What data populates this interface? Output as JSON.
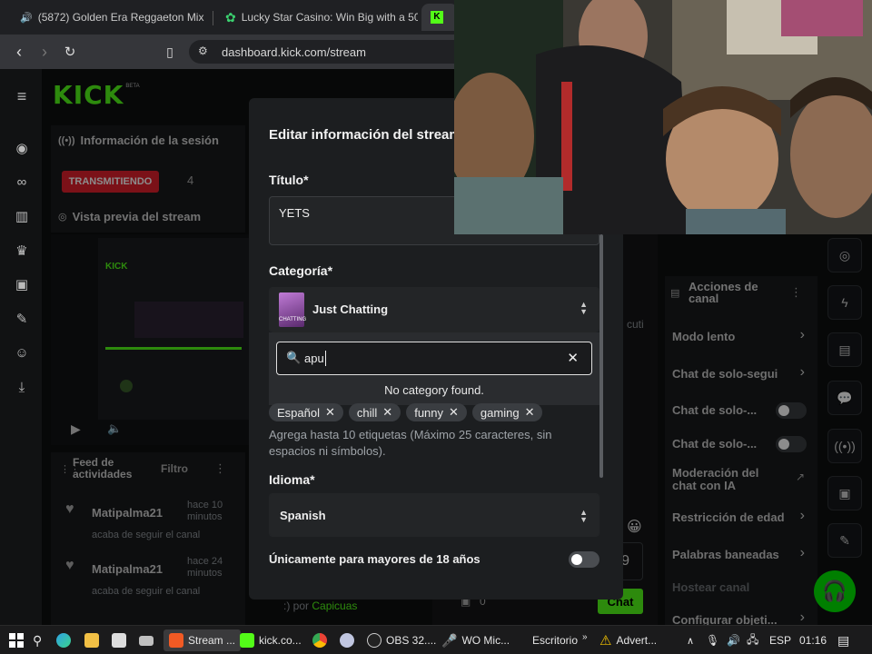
{
  "browser": {
    "tabs": [
      {
        "title": "(5872) Golden Era Reggaeton Mix"
      },
      {
        "title": "Lucky Star Casino: Win Big with a 500"
      },
      {
        "title": ""
      }
    ],
    "url": "dashboard.kick.com/stream"
  },
  "app": {
    "logo": "KICK",
    "logo_badge": "BETA",
    "session_title": "Información de la sesión",
    "live_badge": "TRANSMITIENDO",
    "viewer_count": "4",
    "preview_title": "Vista previa del stream",
    "activity": {
      "title": "Feed de actividades",
      "filter_label": "Filtro",
      "items": [
        {
          "user": "Matipalma21",
          "time": "hace 10 minutos",
          "action": "acaba de seguir el canal"
        },
        {
          "user": "Matipalma21",
          "time": "hace 24 minutos",
          "action": "acaba de seguir el canal"
        }
      ]
    },
    "chat_footer": {
      "by": ":) por",
      "user": "Capicuas",
      "count": "0",
      "send_label": "Chat"
    }
  },
  "channel_actions": {
    "title": "Acciones de canal",
    "items": [
      {
        "label": "Modo lento",
        "control": "chevron"
      },
      {
        "label": "Chat de solo-segui",
        "control": "chevron"
      },
      {
        "label": "Chat de solo-...",
        "control": "toggle"
      },
      {
        "label": "Chat de solo-...",
        "control": "toggle"
      },
      {
        "label": "Moderación del chat con IA",
        "control": "external"
      },
      {
        "label": "Restricción de edad",
        "control": "chevron"
      },
      {
        "label": "Palabras baneadas",
        "control": "chevron"
      },
      {
        "label": "Hostear canal",
        "control": "none"
      },
      {
        "label": "Configurar objeti...",
        "control": "chevron"
      }
    ]
  },
  "modal": {
    "title": "Editar información del stream",
    "title_label": "Título*",
    "title_value": "YETS",
    "category_label": "Categoría*",
    "category_value": "Just Chatting",
    "category_thumb_text": "CHATTING",
    "search": {
      "value": "apu",
      "empty_text": "No category found."
    },
    "tags": [
      "Español",
      "chill",
      "funny",
      "gaming"
    ],
    "tags_help": "Agrega hasta 10 etiquetas (Máximo 25 caracteres, sin espacios ni símbolos).",
    "language_label": "Idioma*",
    "language_value": "Spanish",
    "adult_label": "Únicamente para mayores de 18 años",
    "adult_on": false
  },
  "behind_modal_fragments": {
    "cuti": "cuti",
    "nine": "9"
  },
  "taskbar": {
    "items": [
      {
        "label": "Stream ..."
      },
      {
        "label": "kick.co..."
      },
      {
        "label": "OBS 32...."
      },
      {
        "label": "WO Mic..."
      },
      {
        "label": "Escritorio"
      },
      {
        "label": "Advert..."
      }
    ],
    "lang": "ESP",
    "time": "01:16"
  },
  "colors": {
    "kick_green": "#53fc18",
    "live_red": "#e01f2c",
    "accent_green": "#00e701"
  }
}
